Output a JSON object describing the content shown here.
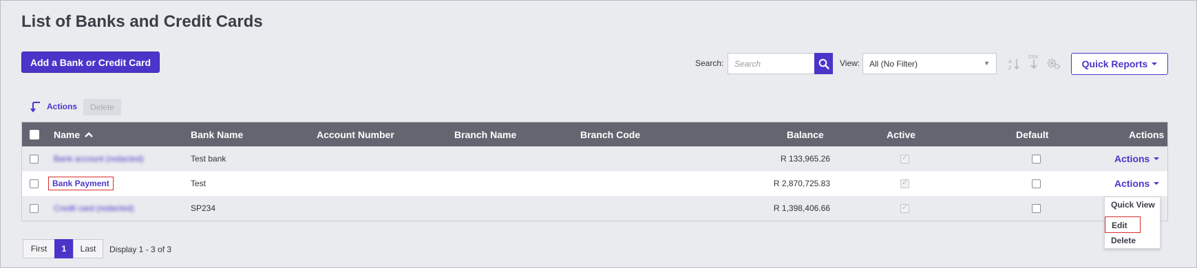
{
  "page": {
    "title": "List of Banks and Credit Cards"
  },
  "toolbar": {
    "add_label": "Add a Bank or Credit Card",
    "search_label": "Search:",
    "search_placeholder": "Search",
    "view_label": "View:",
    "view_value": "All (No Filter)",
    "quick_reports_label": "Quick Reports",
    "csv_label": "CSV"
  },
  "actions_bar": {
    "actions_label": "Actions",
    "delete_label": "Delete"
  },
  "table": {
    "columns": [
      "Name",
      "Bank Name",
      "Account Number",
      "Branch Name",
      "Branch Code",
      "Balance",
      "Active",
      "Default",
      "Actions"
    ],
    "rows": [
      {
        "name": "Bank account (redacted)",
        "bank_name": "Test bank",
        "account_number": "",
        "branch_name": "",
        "branch_code": "",
        "balance": "R 133,965.26",
        "active": true,
        "default": false,
        "actions": "Actions"
      },
      {
        "name": "Bank Payment",
        "bank_name": "Test",
        "account_number": "",
        "branch_name": "",
        "branch_code": "",
        "balance": "R 2,870,725.83",
        "active": true,
        "default": false,
        "actions": "Actions"
      },
      {
        "name": "Credit card (redacted)",
        "bank_name": "SP234",
        "account_number": "",
        "branch_name": "",
        "branch_code": "",
        "balance": "R 1,398,406.66",
        "active": true,
        "default": false,
        "actions": "Actions"
      }
    ]
  },
  "dropdown": {
    "items": [
      "Quick View",
      "Edit",
      "Delete"
    ]
  },
  "pagination": {
    "first": "First",
    "current": "1",
    "last": "Last",
    "info": "Display 1 - 3 of 3"
  },
  "colors": {
    "accent": "#4b35c9",
    "header_bg": "#636671",
    "highlight": "#d62d2d"
  }
}
